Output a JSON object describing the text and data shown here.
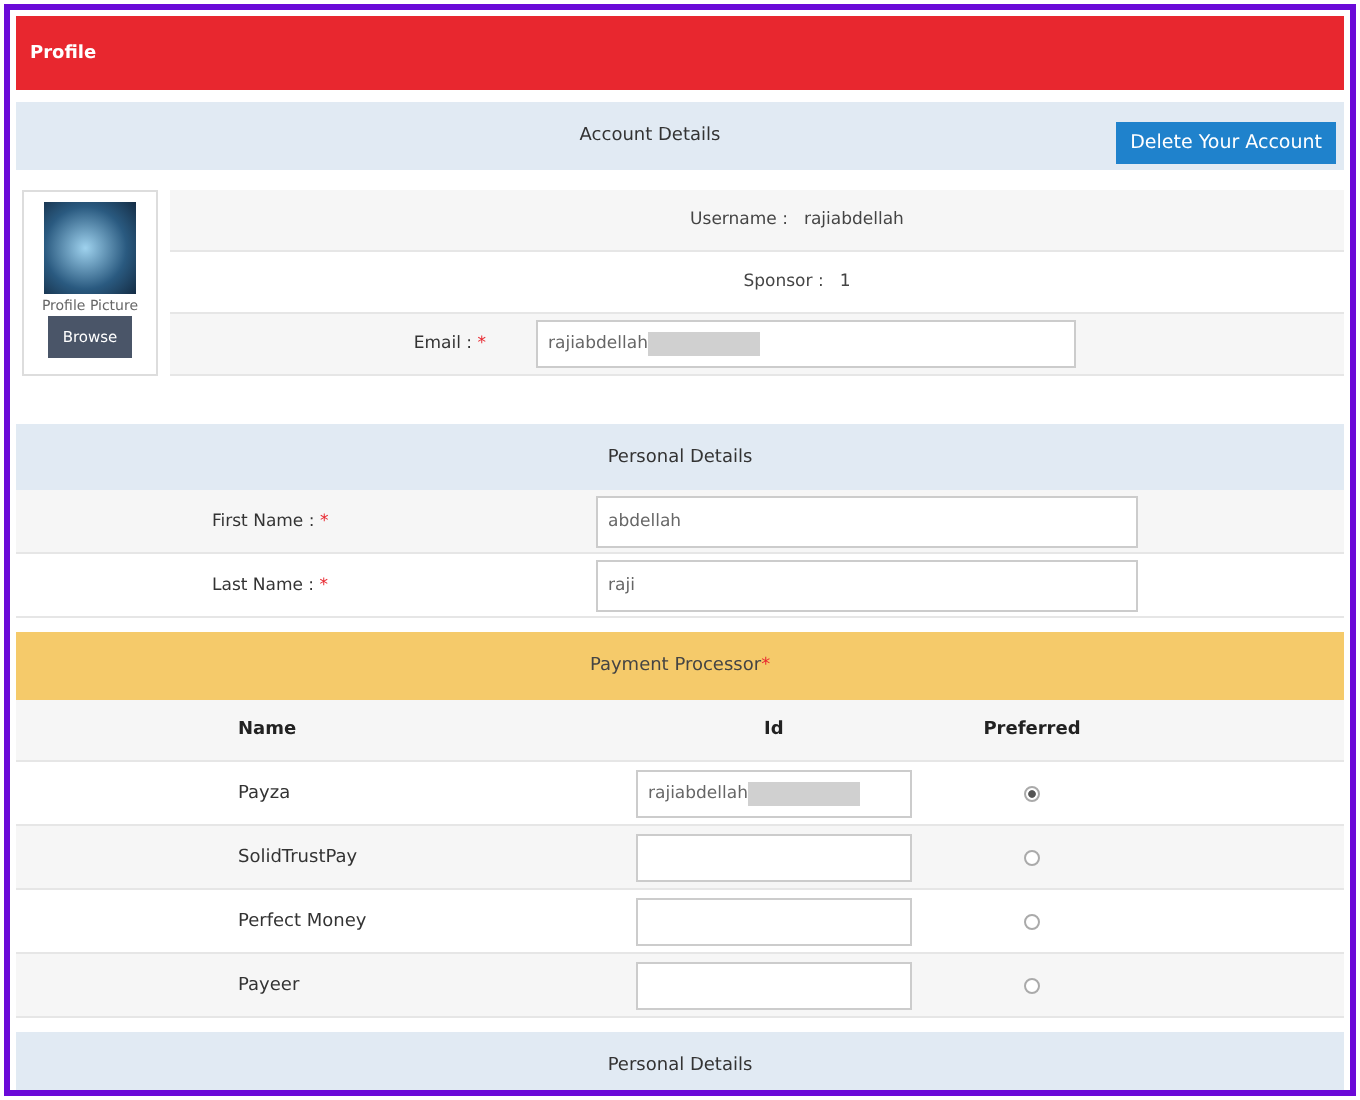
{
  "header": {
    "title": "Profile"
  },
  "account": {
    "title": "Account Details",
    "delete_button": "Delete Your Account",
    "picture_label": "Profile Picture",
    "browse_button": "Browse",
    "fields": [
      {
        "kind": "text",
        "label": "Username :",
        "value": "rajiabdellah"
      },
      {
        "kind": "text",
        "label": "Sponsor :",
        "value": "1"
      },
      {
        "kind": "input",
        "label": "Email :",
        "required": "*",
        "value": "rajiabdellah",
        "redacted": true
      }
    ]
  },
  "personal": {
    "title": "Personal Details",
    "fields": [
      {
        "label": "First Name :",
        "required": "*",
        "value": "abdellah"
      },
      {
        "label": "Last Name :",
        "required": "*",
        "value": "raji"
      }
    ]
  },
  "payment": {
    "title": "Payment Processor",
    "required": "*",
    "columns": [
      "Name",
      "Id",
      "Preferred"
    ],
    "rows": [
      {
        "name": "Payza",
        "value": "rajiabdellah",
        "redacted": true,
        "selected": true
      },
      {
        "name": "SolidTrustPay",
        "value": "",
        "redacted": false,
        "selected": false
      },
      {
        "name": "Perfect Money",
        "value": "",
        "redacted": false,
        "selected": false
      },
      {
        "name": "Payeer",
        "value": "",
        "redacted": false,
        "selected": false
      }
    ]
  },
  "footer_section": {
    "title": "Personal Details"
  }
}
